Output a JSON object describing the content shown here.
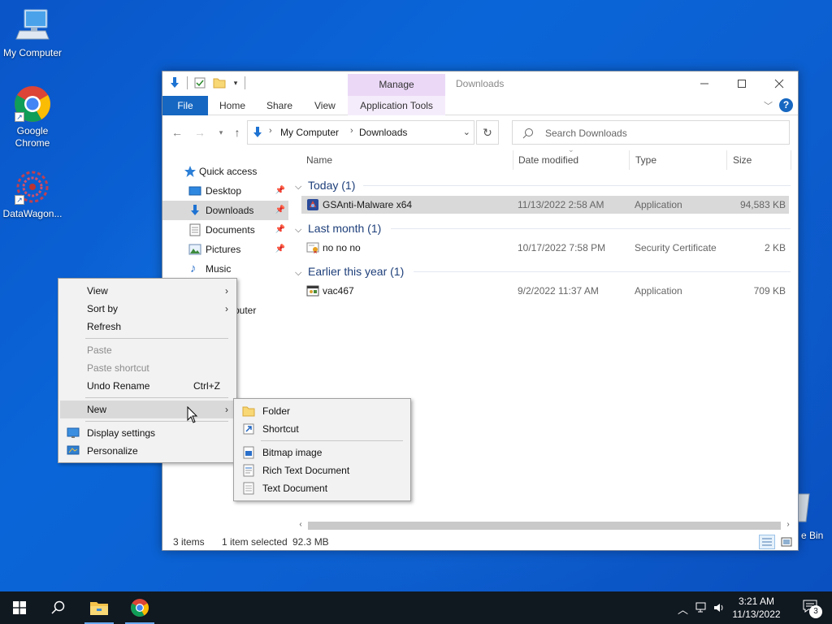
{
  "desktop": {
    "icons": [
      {
        "label": "My Computer"
      },
      {
        "label": "Google Chrome"
      },
      {
        "label": "DataWagon..."
      }
    ],
    "recycle_bin_label": "e Bin"
  },
  "explorer": {
    "title": "Downloads",
    "manage_tab": "Manage",
    "ribbon_tabs": {
      "file": "File",
      "home": "Home",
      "share": "Share",
      "view": "View",
      "app_tools": "Application Tools"
    },
    "help": "?",
    "address": {
      "crumbs": [
        "My Computer",
        "Downloads"
      ]
    },
    "search_placeholder": "Search Downloads",
    "nav_pane": {
      "items": [
        {
          "label": "Quick access"
        },
        {
          "label": "Desktop"
        },
        {
          "label": "Downloads"
        },
        {
          "label": "Documents"
        },
        {
          "label": "Pictures"
        },
        {
          "label": "Music"
        },
        {
          "label": "puter"
        }
      ]
    },
    "columns": {
      "name": "Name",
      "date": "Date modified",
      "type": "Type",
      "size": "Size"
    },
    "groups": [
      {
        "header": "Today (1)",
        "files": [
          {
            "name": "GSAnti-Malware x64",
            "date": "11/13/2022 2:58 AM",
            "type": "Application",
            "size": "94,583 KB",
            "selected": true
          }
        ]
      },
      {
        "header": "Last month (1)",
        "files": [
          {
            "name": "no no no",
            "date": "10/17/2022 7:58 PM",
            "type": "Security Certificate",
            "size": "2 KB",
            "selected": false
          }
        ]
      },
      {
        "header": "Earlier this year (1)",
        "files": [
          {
            "name": "vac467",
            "date": "9/2/2022 11:37 AM",
            "type": "Application",
            "size": "709 KB",
            "selected": false
          }
        ]
      }
    ],
    "status": {
      "items": "3 items",
      "selected": "1 item selected",
      "size": "92.3 MB"
    }
  },
  "context_menu": {
    "view": "View",
    "sort_by": "Sort by",
    "refresh": "Refresh",
    "paste": "Paste",
    "paste_shortcut": "Paste shortcut",
    "undo_rename": "Undo Rename",
    "undo_rename_shortcut": "Ctrl+Z",
    "new": "New",
    "display_settings": "Display settings",
    "personalize": "Personalize"
  },
  "new_submenu": {
    "folder": "Folder",
    "shortcut": "Shortcut",
    "bitmap": "Bitmap image",
    "rtf": "Rich Text Document",
    "text": "Text Document"
  },
  "taskbar": {
    "time": "3:21 AM",
    "date": "11/13/2022",
    "notification_count": "3"
  },
  "colors": {
    "accent": "#1667c1",
    "manage_tab": "#ebd8f7",
    "selection": "#d9d9d9",
    "taskbar": "#101820"
  }
}
